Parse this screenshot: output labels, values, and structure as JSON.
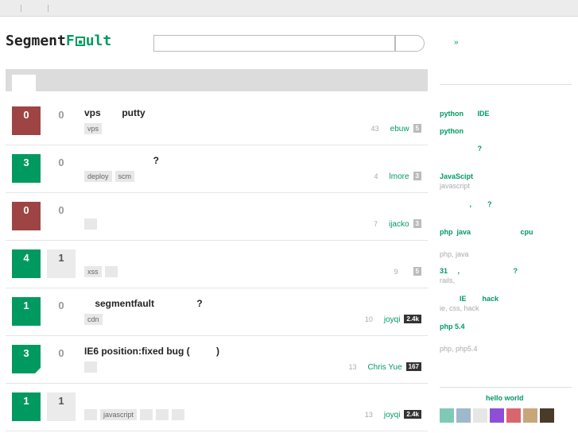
{
  "header": {
    "logo_part1": "Segment",
    "logo_f": "F",
    "logo_part3": "ult",
    "search_placeholder": "",
    "link": "»"
  },
  "questions": [
    {
      "votes": "0",
      "answers": "0",
      "title": "vps        putty",
      "tags": [
        "vps"
      ],
      "views": "43",
      "user": "ebuw",
      "rep": "5"
    },
    {
      "votes": "3",
      "answers": "0",
      "title": "                          ?",
      "tags": [
        "deploy",
        "scm"
      ],
      "views": "4",
      "user": "lmore",
      "rep": "3"
    },
    {
      "votes": "0",
      "answers": "0",
      "title": "",
      "tags": [
        ""
      ],
      "views": "7",
      "user": "ijacko",
      "rep": "3"
    },
    {
      "votes": "4",
      "answers": "1",
      "title": "",
      "tags": [
        "xss",
        ""
      ],
      "views": "9",
      "user": "",
      "rep": "5"
    },
    {
      "votes": "1",
      "answers": "0",
      "title": "    segmentfault                ?",
      "tags": [
        "cdn"
      ],
      "views": "10",
      "user": "joyqi",
      "rep": "2.4k"
    },
    {
      "votes": "3",
      "answers": "0",
      "title": "IE6 position:fixed bug (          )",
      "tags": [
        ""
      ],
      "views": "13",
      "user": "Chris Yue",
      "rep": "167"
    },
    {
      "votes": "1",
      "answers": "1",
      "title": "",
      "tags": [
        "",
        "javascript",
        "",
        "",
        ""
      ],
      "views": "13",
      "user": "joyqi",
      "rep": "2.4k"
    }
  ],
  "sidebar": {
    "items": [
      {
        "title": "python       IDE",
        "sub": ""
      },
      {
        "title": "python",
        "sub": ""
      },
      {
        "title": "                   ?",
        "sub": ""
      },
      {
        "title": "JavaScipt",
        "sub": "javascript"
      },
      {
        "title": "               ,        ?",
        "sub": ""
      },
      {
        "title": "php  java                         cpu",
        "sub": ""
      },
      {
        "title": "",
        "sub": "php, java"
      },
      {
        "title": "31     ,                           ?",
        "sub": "rails,"
      },
      {
        "title": "          IE        hack",
        "sub": "ie, css, hack"
      },
      {
        "title": "php 5.4",
        "sub": ""
      },
      {
        "title": "",
        "sub": "php, php5.4"
      }
    ],
    "hello": "hello world"
  },
  "colors": {
    "accent": "#009a61",
    "negative_vote": "#9e4444",
    "avatars": [
      "#7fcab6",
      "#9fb8cc",
      "#e6e6e6",
      "#8e4fd6",
      "#d9666f",
      "#c9a67a",
      "#4a3a2a"
    ]
  }
}
